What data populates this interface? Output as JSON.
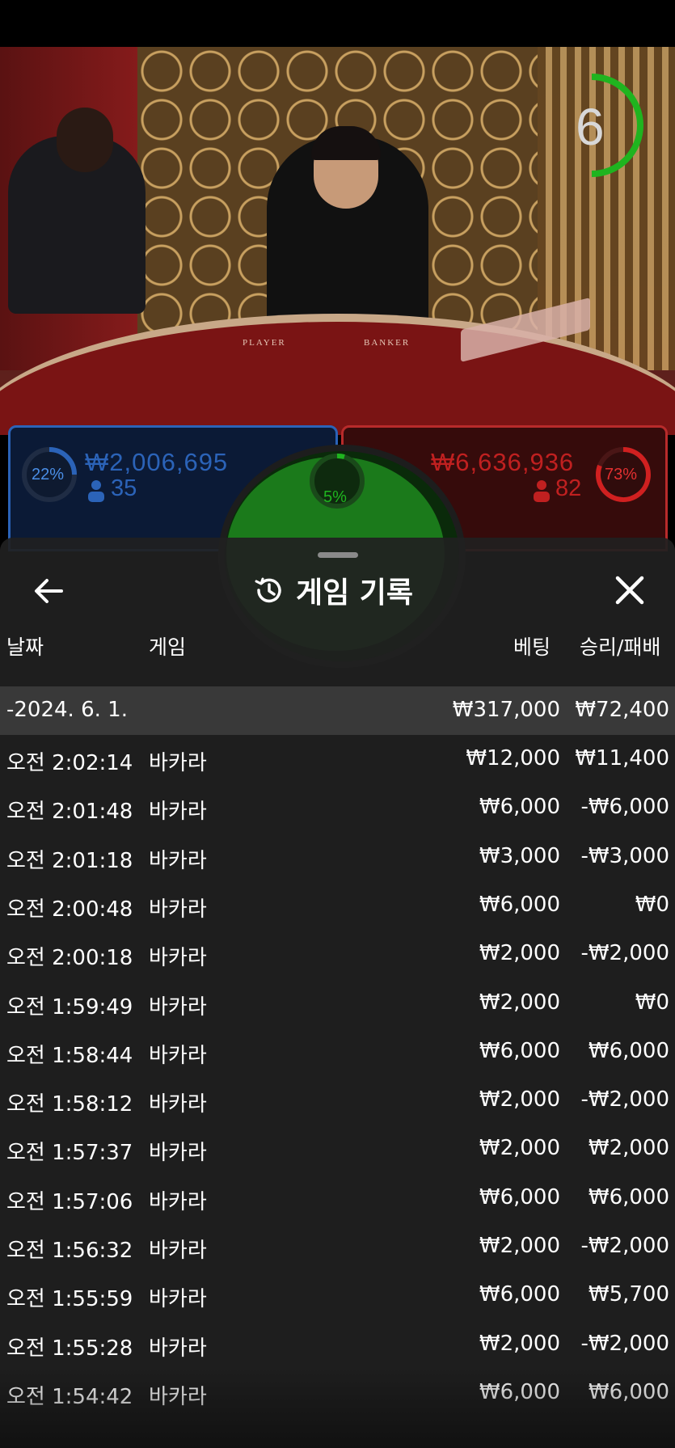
{
  "timer": {
    "value": "6"
  },
  "table": {
    "player_label": "PLAYER",
    "banker_label": "BANKER"
  },
  "bets": {
    "player": {
      "percent": "22%",
      "amount": "₩2,006,695",
      "count": "35"
    },
    "banker": {
      "percent": "73%",
      "amount": "₩6,636,936",
      "count": "82"
    },
    "tie": {
      "percent": "5%"
    },
    "colors": {
      "player": "#2b63b8",
      "banker": "#c02020",
      "tie": "#1fb41f"
    }
  },
  "history": {
    "title": "게임 기록",
    "columns": {
      "date": "날짜",
      "game": "게임",
      "bet": "베팅",
      "result": "승리/패배"
    },
    "group": {
      "date": "-2024. 6. 1.",
      "total_bet": "₩317,000",
      "total_result": "₩72,400"
    },
    "rows": [
      {
        "time": "오전 2:02:14",
        "game": "바카라",
        "bet": "₩12,000",
        "result": "₩11,400"
      },
      {
        "time": "오전 2:01:48",
        "game": "바카라",
        "bet": "₩6,000",
        "result": "-₩6,000"
      },
      {
        "time": "오전 2:01:18",
        "game": "바카라",
        "bet": "₩3,000",
        "result": "-₩3,000"
      },
      {
        "time": "오전 2:00:48",
        "game": "바카라",
        "bet": "₩6,000",
        "result": "₩0"
      },
      {
        "time": "오전 2:00:18",
        "game": "바카라",
        "bet": "₩2,000",
        "result": "-₩2,000"
      },
      {
        "time": "오전 1:59:49",
        "game": "바카라",
        "bet": "₩2,000",
        "result": "₩0"
      },
      {
        "time": "오전 1:58:44",
        "game": "바카라",
        "bet": "₩6,000",
        "result": "₩6,000"
      },
      {
        "time": "오전 1:58:12",
        "game": "바카라",
        "bet": "₩2,000",
        "result": "-₩2,000"
      },
      {
        "time": "오전 1:57:37",
        "game": "바카라",
        "bet": "₩2,000",
        "result": "₩2,000"
      },
      {
        "time": "오전 1:57:06",
        "game": "바카라",
        "bet": "₩6,000",
        "result": "₩6,000"
      },
      {
        "time": "오전 1:56:32",
        "game": "바카라",
        "bet": "₩2,000",
        "result": "-₩2,000"
      },
      {
        "time": "오전 1:55:59",
        "game": "바카라",
        "bet": "₩6,000",
        "result": "₩5,700"
      },
      {
        "time": "오전 1:55:28",
        "game": "바카라",
        "bet": "₩2,000",
        "result": "-₩2,000"
      },
      {
        "time": "오전 1:54:42",
        "game": "바카라",
        "bet": "₩6,000",
        "result": "₩6,000"
      }
    ]
  },
  "icons": {
    "back": "arrow-left-icon",
    "history": "history-clock-icon",
    "close": "close-icon",
    "person": "person-icon"
  }
}
